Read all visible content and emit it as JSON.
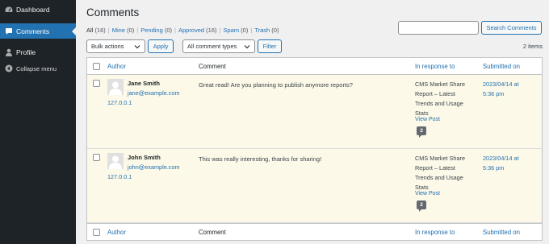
{
  "sidebar": {
    "items": [
      {
        "label": "Dashboard",
        "icon": "dashboard-icon"
      },
      {
        "label": "Comments",
        "icon": "comments-icon",
        "active": true
      },
      {
        "label": "Profile",
        "icon": "profile-icon"
      },
      {
        "label": "Collapse menu",
        "icon": "collapse-icon"
      }
    ]
  },
  "page": {
    "title": "Comments",
    "items_count": "2 items"
  },
  "filters": [
    {
      "label": "All",
      "count": "(16)",
      "current": true
    },
    {
      "label": "Mine",
      "count": "(0)"
    },
    {
      "label": "Pending",
      "count": "(0)"
    },
    {
      "label": "Approved",
      "count": "(16)"
    },
    {
      "label": "Spam",
      "count": "(0)"
    },
    {
      "label": "Trash",
      "count": "(0)"
    }
  ],
  "search": {
    "value": "",
    "button": "Search Comments"
  },
  "toolbar": {
    "bulk_actions": "Bulk actions",
    "apply": "Apply",
    "comment_types": "All comment types",
    "filter": "Filter"
  },
  "table": {
    "headers": {
      "author": "Author",
      "comment": "Comment",
      "in_response_to": "In response to",
      "submitted_on": "Submitted on"
    },
    "rows": [
      {
        "author_name": "Jane Smith",
        "author_email": "jane@example.com",
        "author_ip": "127.0.0.1",
        "comment": "Great read! Are you planning to publish anymore reports?",
        "response_lines": [
          "CMS Market Share",
          "Report – Latest",
          "Trends and Usage",
          "Stats"
        ],
        "view_post": "View Post",
        "comment_count": "2",
        "submitted_lines": [
          "2023/04/14 at",
          "5:36 pm"
        ]
      },
      {
        "author_name": "John Smith",
        "author_email": "john@example.com",
        "author_ip": "127.0.0.1",
        "comment": "This was really interesting, thanks for sharing!",
        "response_lines": [
          "CMS Market Share",
          "Report – Latest",
          "Trends and Usage",
          "Stats"
        ],
        "view_post": "View Post",
        "comment_count": "2",
        "submitted_lines": [
          "2023/04/14 at",
          "5:36 pm"
        ]
      }
    ]
  },
  "colors": {
    "sidebar_bg": "#1d2327",
    "accent": "#2271b1",
    "row_highlight": "#fcf9e8"
  }
}
